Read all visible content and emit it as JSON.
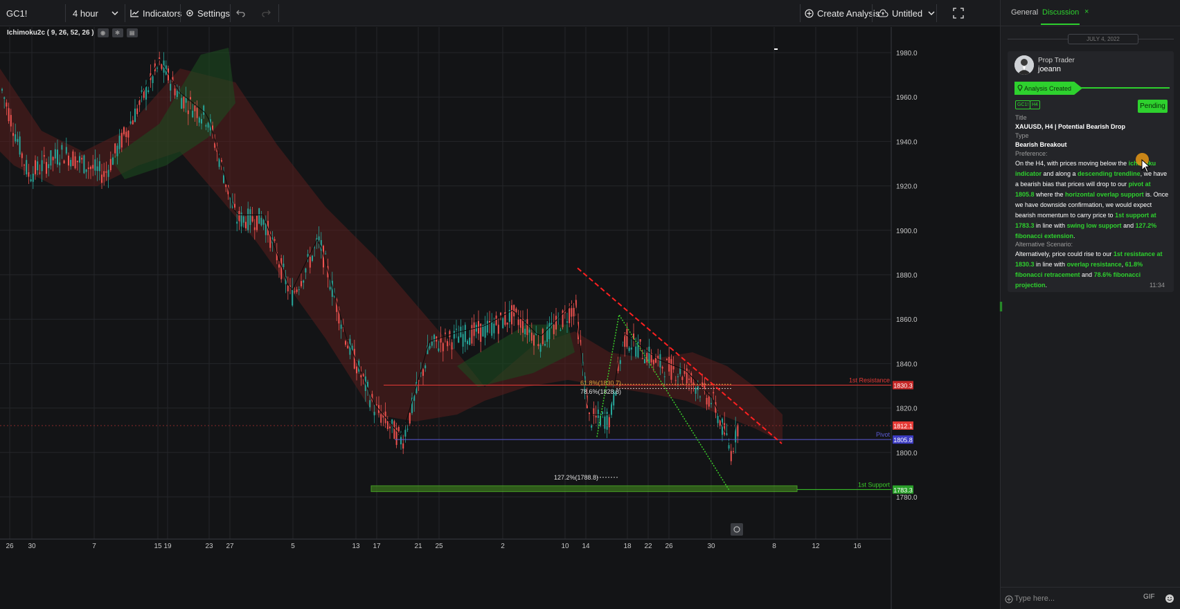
{
  "toolbar": {
    "symbol": "GC1!",
    "interval": "4 hour",
    "indicators_label": "Indicators",
    "settings_label": "Settings",
    "create_analysis_label": "Create Analysis",
    "layout_name": "Untitled"
  },
  "indicator": {
    "label": "Ichimoku2c ( 9, 26, 52, 26 )"
  },
  "price_axis": {
    "ticks": [
      "1980.0",
      "1960.0",
      "1940.0",
      "1920.0",
      "1900.0",
      "1880.0",
      "1860.0",
      "1840.0",
      "1820.0",
      "1800.0",
      "1780.0"
    ]
  },
  "time_axis": {
    "ticks": [
      "26",
      "30",
      "7",
      "15",
      "19",
      "23",
      "27",
      "5",
      "13",
      "17",
      "21",
      "25",
      "2",
      "10",
      "14",
      "18",
      "22",
      "26",
      "30",
      "8",
      "12",
      "16"
    ]
  },
  "levels": {
    "resistance_label": "1st Resistance",
    "resistance_price": "1830.3",
    "current_price": "1812.1",
    "pivot_label": "Pivot",
    "pivot_price": "1805.8",
    "support_label": "1st Support",
    "support_price": "1783.3",
    "fib_618": "61.8%(1830.7)",
    "fib_786": "78.6%(1828.8)",
    "fib_1272": "127.2%(1788.8)"
  },
  "panel": {
    "tab_general": "General",
    "tab_discussion": "Discussion",
    "date": "JULY 4, 2022",
    "role": "Prop Trader",
    "username": "joeann",
    "created_label": "Analysis Created",
    "tags": [
      "GC1!",
      "H4"
    ],
    "status": "Pending",
    "title_label": "Title",
    "title_value": "XAUUSD, H4 | Potential Bearish Drop",
    "type_label": "Type",
    "type_value": "Bearish Breakout",
    "preference_label": "Preference:",
    "pref": {
      "t1": "On the H4, with prices moving below the ",
      "g1": "ichimoku indicator",
      "t2": " and along a ",
      "g2": "descending trendline",
      "t3": ", we have a bearish bias that prices will drop to our ",
      "g3": "pivot at 1805.8",
      "t4": " where the ",
      "g4": "horizontal overlap support",
      "t5": " is. Once we have downside confirmation, we would expect bearish momentum to carry price to ",
      "g5": "1st support at 1783.3",
      "t6": " in line with ",
      "g6": "swing low support",
      "t7": " and ",
      "g7": "127.2% fibonacci extension",
      "t8": "."
    },
    "alt_label": "Alternative Scenario:",
    "alt": {
      "t1": "Alternatively, price could rise to our ",
      "g1": "1st resistance  at 1830.3",
      "t2": " in line with ",
      "g2": "overlap resistance",
      "t3": ", ",
      "g3": "61.8% fibonacci retracement",
      "t4": " and ",
      "g4": "78.6% fibonacci projection",
      "t5": "."
    },
    "time": "11:34",
    "input_placeholder": "Type here...",
    "gif_label": "GIF"
  },
  "colors": {
    "accent_green": "#2ed12e",
    "bull": "#26a69a",
    "bear": "#ef5350",
    "resistance": "#e53935",
    "pivot": "#5b5bd6"
  }
}
